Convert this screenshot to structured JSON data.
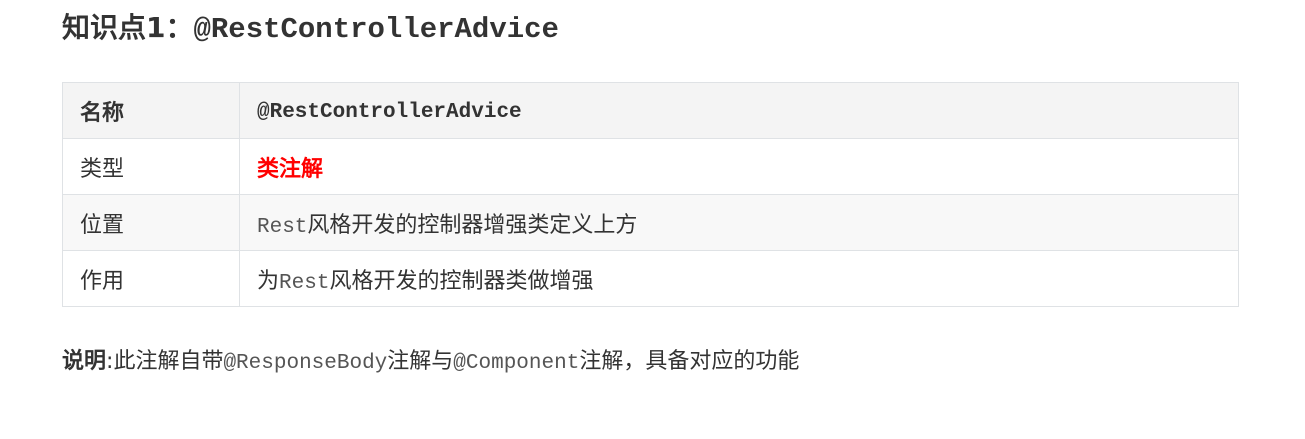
{
  "heading": {
    "prefix": "知识点1：",
    "code": "@RestControllerAdvice"
  },
  "table": {
    "header": {
      "label": "名称",
      "value": "@RestControllerAdvice"
    },
    "rows": [
      {
        "label": "类型",
        "value": "类注解"
      },
      {
        "label": "位置",
        "code": "Rest",
        "text": "风格开发的控制器增强类定义上方"
      },
      {
        "label": "作用",
        "text_before": "为",
        "code": "Rest",
        "text_after": "风格开发的控制器类做增强"
      }
    ]
  },
  "note": {
    "label": "说明",
    "separator": ":",
    "text1": "此注解自带",
    "code1": "@ResponseBody",
    "text2": "注解与",
    "code2": "@Component",
    "text3": "注解，具备对应的功能"
  },
  "colors": {
    "text": "#333333",
    "emphasis": "#ff0000",
    "border": "#dfe2e5",
    "header_bg": "#f4f4f4",
    "alt_row_bg": "#f8f8f8"
  }
}
